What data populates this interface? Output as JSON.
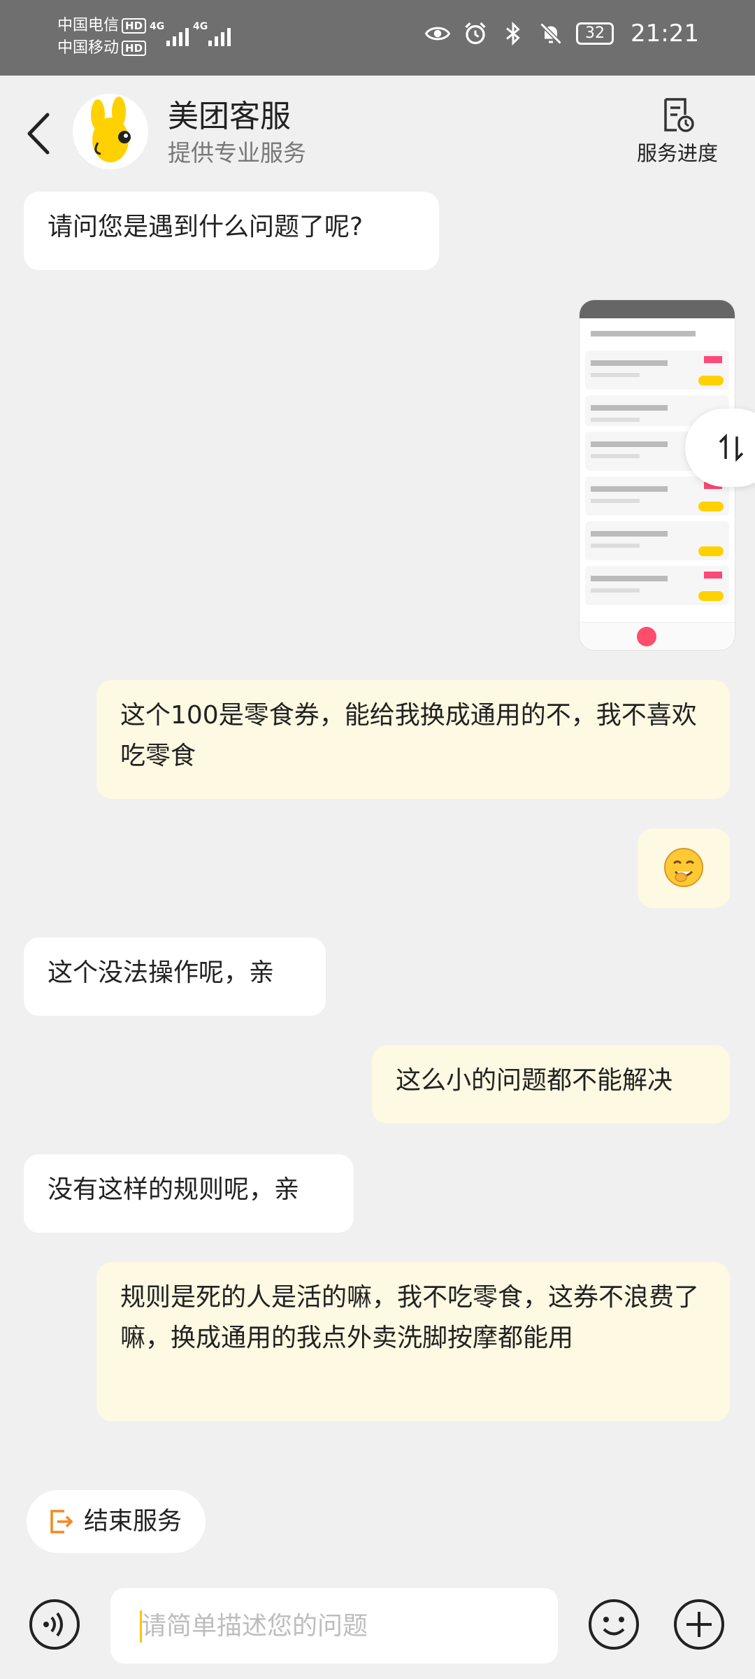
{
  "status_bar": {
    "carrier1": "中国电信",
    "carrier2": "中国移动",
    "hd": "HD",
    "network1": "4G",
    "network2": "4G",
    "battery": "32",
    "time": "21:21"
  },
  "header": {
    "title": "美团客服",
    "subtitle": "提供专业服务",
    "progress_label": "服务进度"
  },
  "messages": [
    {
      "from": "bot",
      "text": "请问您是遇到什么问题了呢?"
    },
    {
      "from": "me",
      "type": "image",
      "text": ""
    },
    {
      "from": "me",
      "text": "这个100是零食券，能给我换成通用的不，我不喜欢吃零食"
    },
    {
      "from": "me",
      "type": "emoji",
      "text": ""
    },
    {
      "from": "bot",
      "text": "这个没法操作呢，亲"
    },
    {
      "from": "me",
      "text": "这么小的问题都不能解决"
    },
    {
      "from": "bot",
      "text": "没有这样的规则呢，亲"
    },
    {
      "from": "me",
      "text": "规则是死的人是活的嘛，我不吃零食，这券不浪费了嘛，换成通用的我点外卖洗脚按摩都能用"
    }
  ],
  "end_service_label": "结束服务",
  "input": {
    "placeholder": "请简单描述您的问题",
    "value": ""
  },
  "icons": {
    "back": "back-arrow-icon",
    "progress": "document-clock-icon",
    "swap": "swap-arrows-icon",
    "end": "exit-icon",
    "voice": "voice-icon",
    "emoji": "smiley-icon",
    "plus": "plus-icon"
  },
  "colors": {
    "accent": "#ffc300",
    "end_icon": "#f08a24",
    "my_bubble": "#fdf9e2",
    "bot_bubble": "#ffffff",
    "status_bar": "#6f6f6f"
  }
}
